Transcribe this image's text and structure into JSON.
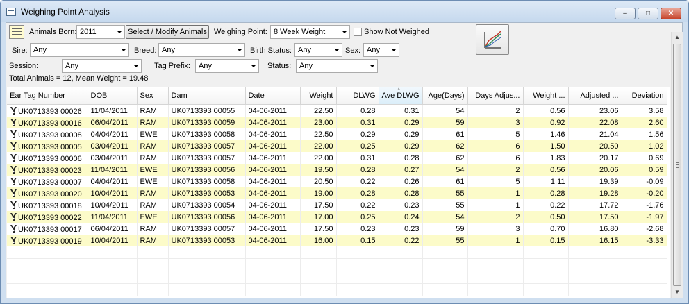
{
  "window": {
    "title": "Weighing Point Analysis",
    "controls": [
      "–",
      "□",
      "✕"
    ]
  },
  "toolbar": {
    "animals_born_label": "Animals Born:",
    "animals_born_value": "2011",
    "select_modify_button": "Select / Modify Animals",
    "weighing_point_label": "Weighing Point:",
    "weighing_point_value": "8 Week Weight",
    "show_not_weighed_label": "Show Not Weighed",
    "show_not_weighed_checked": false,
    "sire_label": "Sire:",
    "sire_value": "Any",
    "breed_label": "Breed:",
    "breed_value": "Any",
    "birth_status_label": "Birth Status:",
    "birth_status_value": "Any",
    "sex_label": "Sex:",
    "sex_value": "Any",
    "session_label": "Session:",
    "session_value": "Any",
    "tag_prefix_label": "Tag Prefix:",
    "tag_prefix_value": "Any",
    "status_label": "Status:",
    "status_value": "Any",
    "summary": "Total Animals = 12, Mean Weight = 19.48"
  },
  "grid": {
    "columns": [
      "Ear Tag Number",
      "DOB",
      "Sex",
      "Dam",
      "Date",
      "Weight",
      "DLWG",
      "Ave DLWG",
      "Age(Days)",
      "Days Adjus...",
      "Weight ...",
      "Adjusted ...",
      "Deviation"
    ],
    "sorted_column": "Ave DLWG",
    "rows": [
      [
        "UK0713393 00026",
        "11/04/2011",
        "RAM",
        "UK0713393 00055",
        "04-06-2011",
        "22.50",
        "0.28",
        "0.31",
        "54",
        "2",
        "0.56",
        "23.06",
        "3.58"
      ],
      [
        "UK0713393 00016",
        "06/04/2011",
        "RAM",
        "UK0713393 00059",
        "04-06-2011",
        "23.00",
        "0.31",
        "0.29",
        "59",
        "3",
        "0.92",
        "22.08",
        "2.60"
      ],
      [
        "UK0713393 00008",
        "04/04/2011",
        "EWE",
        "UK0713393 00058",
        "04-06-2011",
        "22.50",
        "0.29",
        "0.29",
        "61",
        "5",
        "1.46",
        "21.04",
        "1.56"
      ],
      [
        "UK0713393 00005",
        "03/04/2011",
        "RAM",
        "UK0713393 00057",
        "04-06-2011",
        "22.00",
        "0.25",
        "0.29",
        "62",
        "6",
        "1.50",
        "20.50",
        "1.02"
      ],
      [
        "UK0713393 00006",
        "03/04/2011",
        "RAM",
        "UK0713393 00057",
        "04-06-2011",
        "22.00",
        "0.31",
        "0.28",
        "62",
        "6",
        "1.83",
        "20.17",
        "0.69"
      ],
      [
        "UK0713393 00023",
        "11/04/2011",
        "EWE",
        "UK0713393 00056",
        "04-06-2011",
        "19.50",
        "0.28",
        "0.27",
        "54",
        "2",
        "0.56",
        "20.06",
        "0.59"
      ],
      [
        "UK0713393 00007",
        "04/04/2011",
        "EWE",
        "UK0713393 00058",
        "04-06-2011",
        "20.50",
        "0.22",
        "0.26",
        "61",
        "5",
        "1.11",
        "19.39",
        "-0.09"
      ],
      [
        "UK0713393 00020",
        "10/04/2011",
        "RAM",
        "UK0713393 00053",
        "04-06-2011",
        "19.00",
        "0.28",
        "0.28",
        "55",
        "1",
        "0.28",
        "19.28",
        "-0.20"
      ],
      [
        "UK0713393 00018",
        "10/04/2011",
        "RAM",
        "UK0713393 00054",
        "04-06-2011",
        "17.50",
        "0.22",
        "0.23",
        "55",
        "1",
        "0.22",
        "17.72",
        "-1.76"
      ],
      [
        "UK0713393 00022",
        "11/04/2011",
        "EWE",
        "UK0713393 00056",
        "04-06-2011",
        "17.00",
        "0.25",
        "0.24",
        "54",
        "2",
        "0.50",
        "17.50",
        "-1.97"
      ],
      [
        "UK0713393 00017",
        "06/04/2011",
        "RAM",
        "UK0713393 00057",
        "04-06-2011",
        "17.50",
        "0.23",
        "0.23",
        "59",
        "3",
        "0.70",
        "16.80",
        "-2.68"
      ],
      [
        "UK0713393 00019",
        "10/04/2011",
        "RAM",
        "UK0713393 00053",
        "04-06-2011",
        "16.00",
        "0.15",
        "0.22",
        "55",
        "1",
        "0.15",
        "16.15",
        "-3.33"
      ]
    ],
    "row_icon": "sheep-tag-icon",
    "alt_row_color": "#fcfbc9"
  }
}
